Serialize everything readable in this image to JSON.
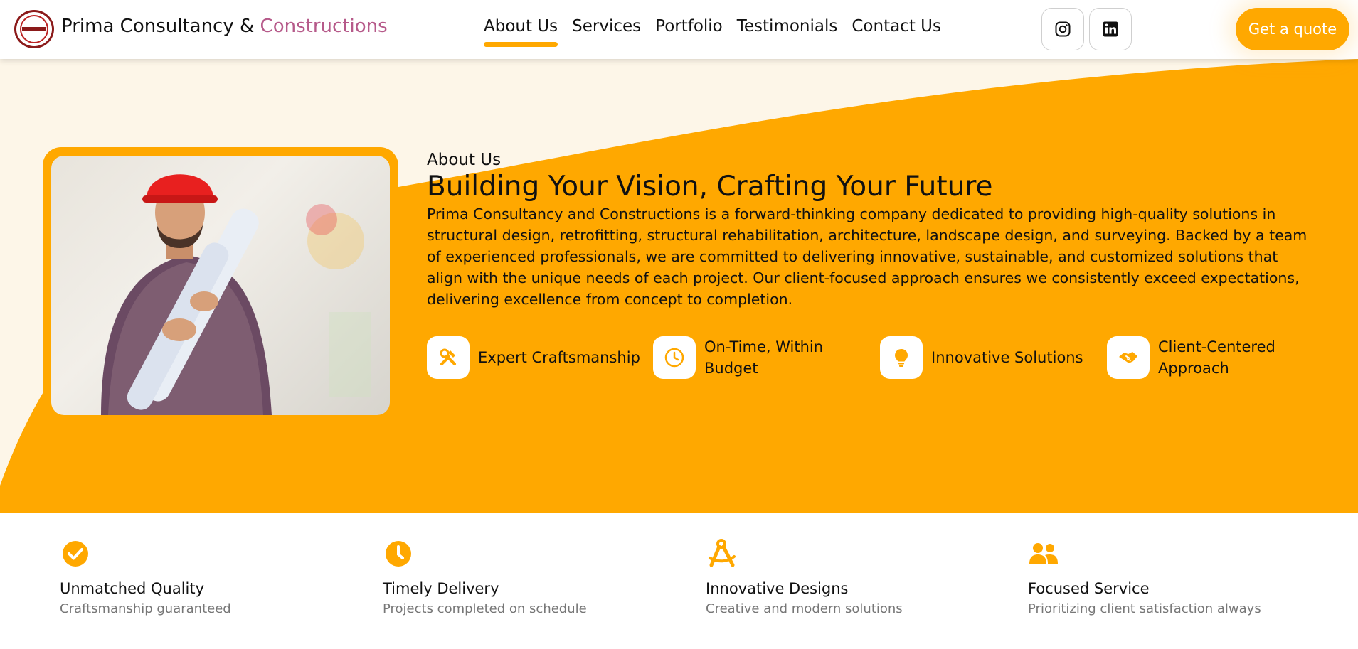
{
  "header": {
    "brand_name": "Prima Consultancy &",
    "brand_accent": "Constructions",
    "nav": [
      {
        "label": "About Us",
        "active": true
      },
      {
        "label": "Services",
        "active": false
      },
      {
        "label": "Portfolio",
        "active": false
      },
      {
        "label": "Testimonials",
        "active": false
      },
      {
        "label": "Contact Us",
        "active": false
      }
    ],
    "social": [
      "instagram-icon",
      "linkedin-icon"
    ],
    "cta_label": "Get a quote"
  },
  "hero": {
    "eyebrow": "About Us",
    "headline": "Building Your Vision, Crafting Your Future",
    "description": "Prima Consultancy and Constructions is a forward-thinking company dedicated to providing high-quality solutions in structural design, retrofitting, structural rehabilitation, architecture, landscape design, and surveying. Backed by a team of experienced professionals, we are committed to delivering innovative, sustainable, and customized solutions that align with the unique needs of each project. Our client-focused approach ensures we consistently exceed expectations, delivering excellence from concept to completion.",
    "features": [
      {
        "icon": "tools-icon",
        "label": "Expert Craftsmanship"
      },
      {
        "icon": "clock-icon",
        "label": "On-Time, Within Budget"
      },
      {
        "icon": "lightbulb-icon",
        "label": "Innovative Solutions"
      },
      {
        "icon": "handshake-icon",
        "label": "Client-Centered Approach"
      }
    ]
  },
  "highlights": [
    {
      "icon": "check-circle-icon",
      "title": "Unmatched Quality",
      "subtitle": "Craftsmanship guaranteed"
    },
    {
      "icon": "clock-icon",
      "title": "Timely Delivery",
      "subtitle": "Projects completed on schedule"
    },
    {
      "icon": "compass-icon",
      "title": "Innovative Designs",
      "subtitle": "Creative and modern solutions"
    },
    {
      "icon": "users-icon",
      "title": "Focused Service",
      "subtitle": "Prioritizing client satisfaction always"
    }
  ],
  "colors": {
    "accent": "#ffa800",
    "brand_accent_text": "#b65a8a",
    "background": "#fdf6e8"
  }
}
